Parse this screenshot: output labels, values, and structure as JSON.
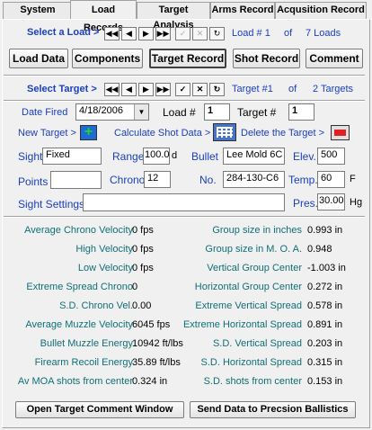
{
  "tabs": [
    "System",
    "Load Records",
    "Target Analysis",
    "Arms Record",
    "Acqusition Record"
  ],
  "load_nav": {
    "label": "Select a Load >",
    "record_prefix": "Load #",
    "record_num": "1",
    "of": "of",
    "count_text": "7 Loads"
  },
  "sub_tabs": [
    "Load Data",
    "Components",
    "Target Record",
    "Shot Record",
    "Comment"
  ],
  "target_nav": {
    "label": "Select Target >",
    "record_prefix": "Target #1",
    "of": "of",
    "count_text": "2 Targets"
  },
  "form": {
    "date_label": "Date Fired",
    "date_value": "4/18/2006",
    "load_label": "Load #",
    "load_value": "1",
    "target_label": "Target #",
    "target_value": "1",
    "new_target": "New Target >",
    "calc": "Calculate Shot Data >",
    "delete": "Delete the Target >",
    "sight_label": "Sight",
    "sight_value": "Fixed",
    "range_label": "Range",
    "range_value": "100.0",
    "range_unit": "d",
    "bullet_label": "Bullet",
    "bullet_value": "Lee Mold 6C",
    "elev_label": "Elev.",
    "elev_value": "500",
    "points_label": "Points",
    "points_value": "",
    "chrono_label": "Chrono",
    "chrono_value": "12",
    "no_label": "No.",
    "no_value": "284-130-C6",
    "temp_label": "Temp.",
    "temp_value": "60",
    "temp_unit": "F",
    "sight_settings_label": "Sight Settings",
    "sight_settings_value": "",
    "pres_label": "Pres.",
    "pres_value": "30.00",
    "pres_unit": "Hg"
  },
  "stats_left": [
    {
      "label": "Average Chrono Velocity",
      "value": "0 fps"
    },
    {
      "label": "High Velocity",
      "value": "0 fps"
    },
    {
      "label": "Low Velocity",
      "value": "0 fps"
    },
    {
      "label": "Extreme Spread  Chrono",
      "value": "0"
    },
    {
      "label": "S.D. Chrono Vel.",
      "value": "0.00"
    },
    {
      "label": "Average Muzzle Velocity",
      "value": "6045 fps"
    },
    {
      "label": "Bullet Muzzle Energy",
      "value": "10942 ft/lbs"
    },
    {
      "label": "Firearm Recoil Energy",
      "value": "35.89 ft/lbs"
    },
    {
      "label": "Av MOA shots from center",
      "value": "0.324 in"
    }
  ],
  "stats_right": [
    {
      "label": "Group size in inches",
      "value": "0.993 in"
    },
    {
      "label": "Group size in M. O. A.",
      "value": "0.948"
    },
    {
      "label": "Vertical Group Center",
      "value": "-1.003 in"
    },
    {
      "label": "Horizontal Group Center",
      "value": "0.272 in"
    },
    {
      "label": "Extreme Vertical Spread",
      "value": "0.578 in"
    },
    {
      "label": "Extreme Horizontal Spread",
      "value": "0.891 in"
    },
    {
      "label": "S.D. Vertical Spread",
      "value": "0.203 in"
    },
    {
      "label": "S.D. Horizontal Spread",
      "value": "0.315 in"
    },
    {
      "label": "S.D. shots from center",
      "value": "0.153 in"
    }
  ],
  "bottom_buttons": [
    "Open Target Comment Window",
    "Send Data to Precsion Ballistics"
  ]
}
